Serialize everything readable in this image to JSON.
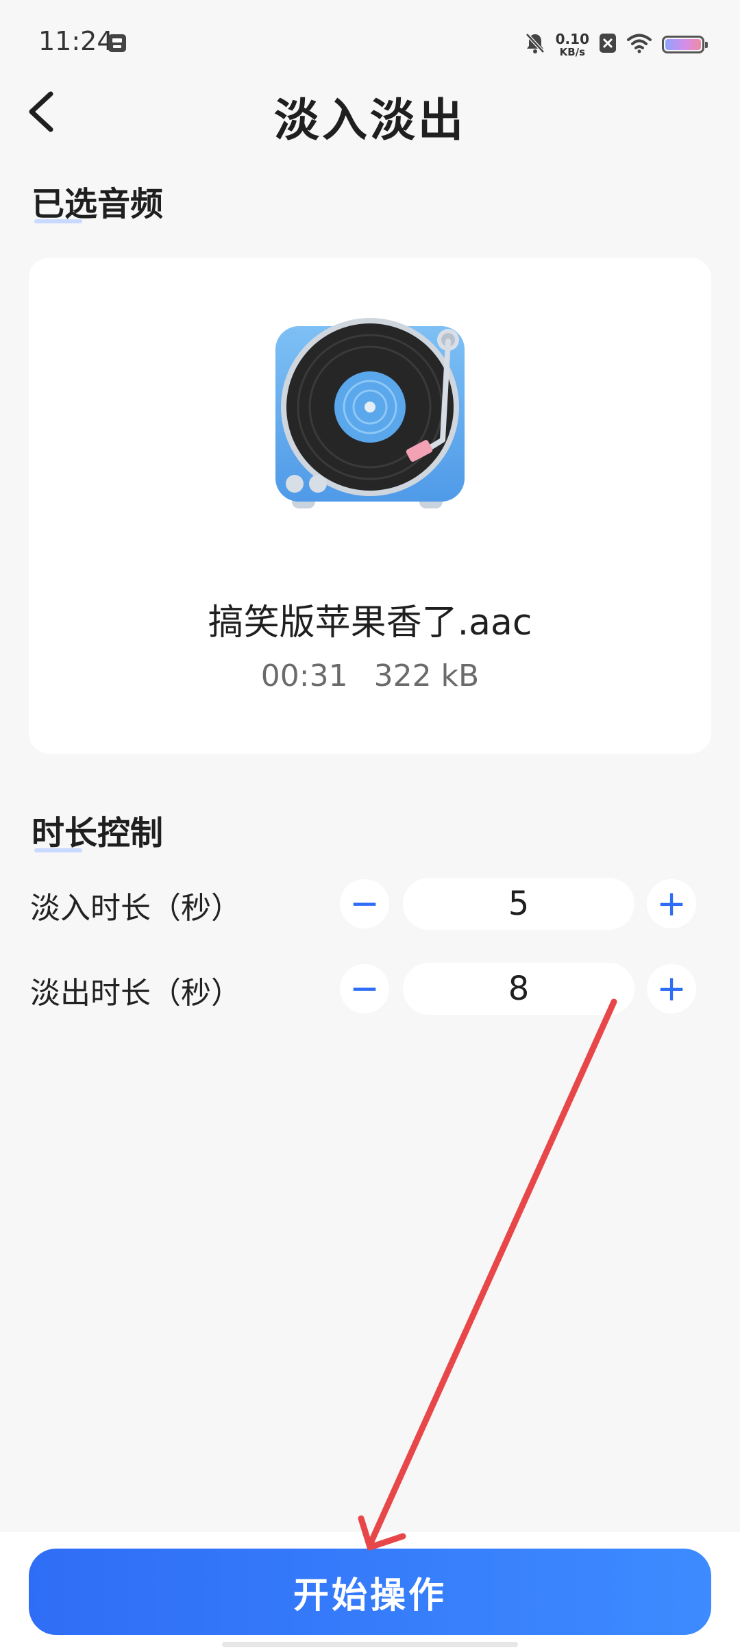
{
  "status_bar": {
    "time": "11:24",
    "net_speed_value": "0.10",
    "net_speed_unit": "KB/s",
    "icons": [
      "save-icon",
      "bell-off-icon",
      "sim-off-icon",
      "wifi-icon",
      "battery-icon"
    ]
  },
  "header": {
    "title": "淡入淡出",
    "back_icon": "chevron-left-icon"
  },
  "selected_audio": {
    "section_title": "已选音频",
    "thumbnail_icon": "turntable-icon",
    "file_name": "搞笑版苹果香了.aac",
    "duration": "00:31",
    "size": "322 kB"
  },
  "duration_control": {
    "section_title": "时长控制",
    "fade_in": {
      "label": "淡入时长（秒）",
      "value": "5",
      "minus": "−",
      "plus": "+"
    },
    "fade_out": {
      "label": "淡出时长（秒）",
      "value": "8",
      "minus": "−",
      "plus": "+"
    }
  },
  "actions": {
    "start_label": "开始操作"
  },
  "colors": {
    "accent": "#2f6df6",
    "background": "#f7f7f7",
    "card": "#ffffff",
    "annotation_arrow": "#e8474a"
  }
}
